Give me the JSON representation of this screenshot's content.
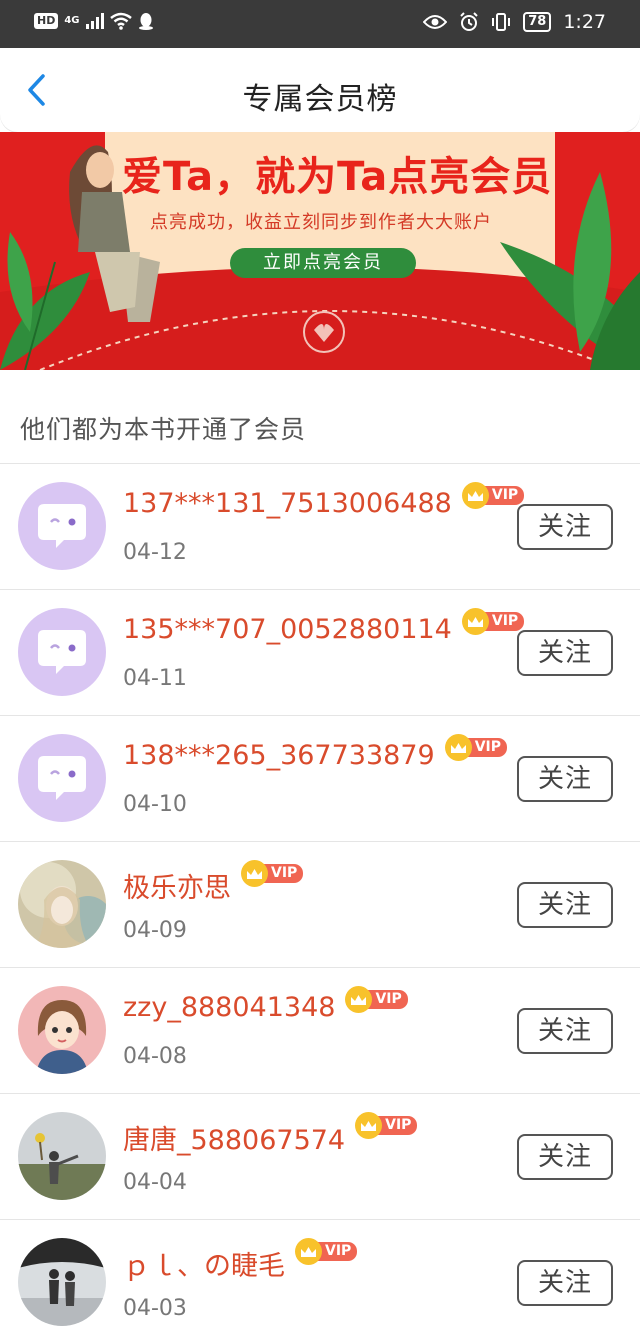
{
  "status_bar": {
    "hd": "HD",
    "network": "4G",
    "battery": "78",
    "time": "1:27"
  },
  "header": {
    "title": "专属会员榜"
  },
  "banner": {
    "title": "爱Ta，就为Ta点亮会员",
    "subtitle": "点亮成功，收益立刻同步到作者大大账户",
    "button_label": "立即点亮会员"
  },
  "section": {
    "title": "他们都为本书开通了会员"
  },
  "vip_label": "VIP",
  "follow_label": "关注",
  "members": [
    {
      "name": "137***131_7513006488",
      "date": "04-12",
      "avatar": "default-chat-avatar"
    },
    {
      "name": "135***707_0052880114",
      "date": "04-11",
      "avatar": "default-chat-avatar"
    },
    {
      "name": "138***265_367733879",
      "date": "04-10",
      "avatar": "default-chat-avatar"
    },
    {
      "name": "极乐亦思",
      "date": "04-09",
      "avatar": "illustrated-girl-avatar"
    },
    {
      "name": "zzy_888041348",
      "date": "04-08",
      "avatar": "cartoon-woman-avatar"
    },
    {
      "name": "唐唐_588067574",
      "date": "04-04",
      "avatar": "field-photo-avatar"
    },
    {
      "name": "ｐｌ、の睫毛",
      "date": "04-03",
      "avatar": "couple-photo-avatar"
    }
  ],
  "colors": {
    "accent_blue": "#1e88e5",
    "name_red": "#d94b2c",
    "vip_gold": "#f8c22b",
    "vip_red": "#f06552",
    "banner_red": "#e0201f",
    "banner_green": "#2f8d3c"
  }
}
